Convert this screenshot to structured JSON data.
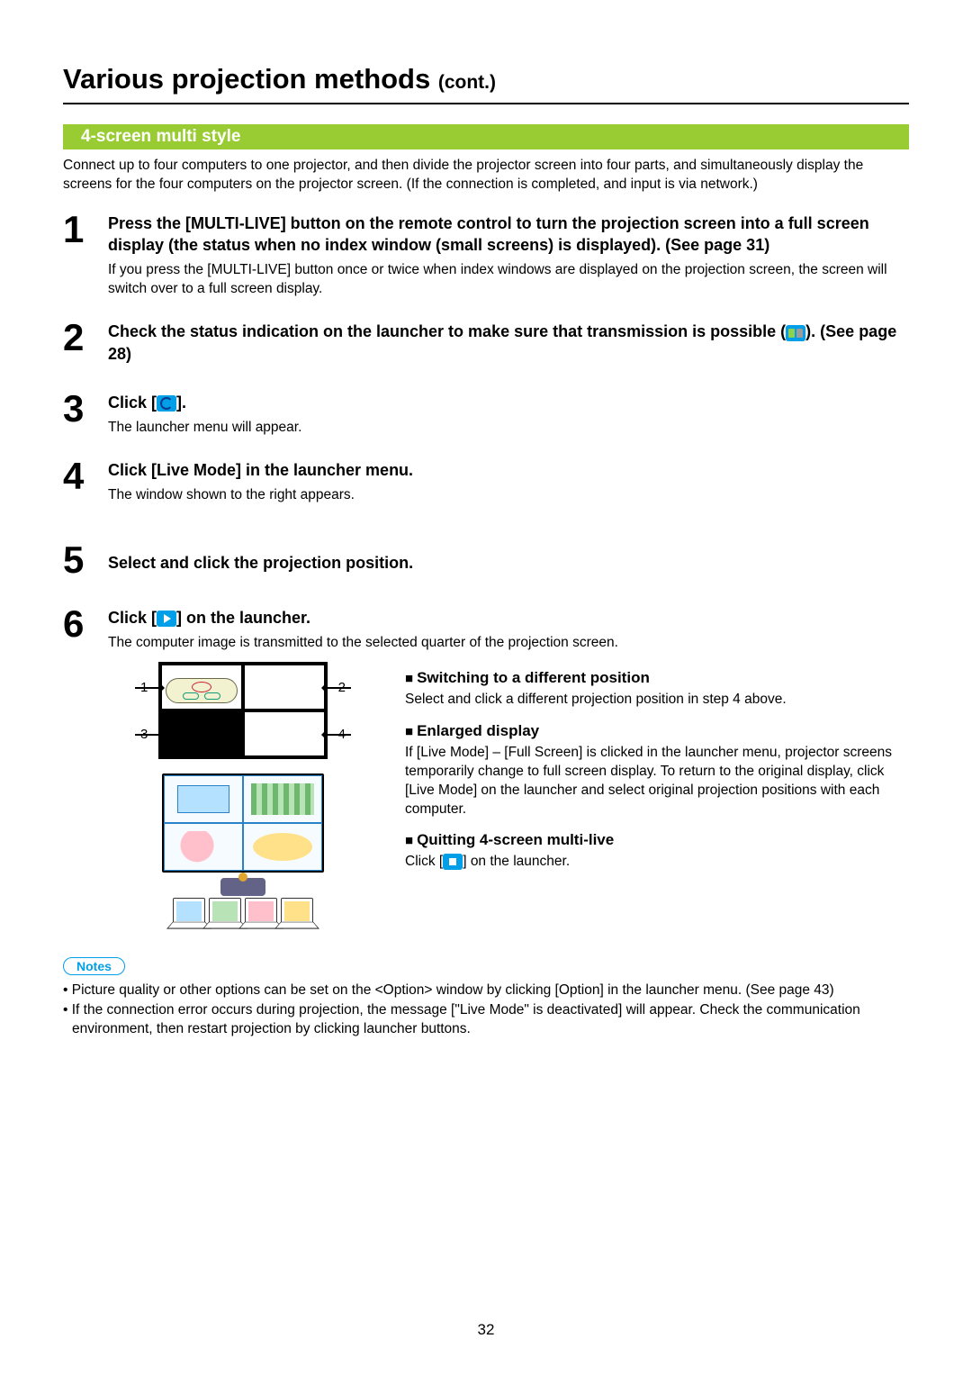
{
  "title_main": "Various projection methods ",
  "title_cont": "(cont.)",
  "section_heading": "4-screen multi style",
  "intro": "Connect up to four computers to one projector, and then divide the projector screen into four parts, and simultaneously display the screens for the four computers on the projector screen. (If the connection is completed, and input is via network.)",
  "steps": {
    "1": {
      "head": "Press the [MULTI-LIVE] button on the remote control to turn the projection screen into a full screen display (the status when no index window (small screens) is displayed). (See page 31)",
      "sub": "If you press the [MULTI-LIVE] button once or twice when index windows are displayed on the projection screen, the screen will switch over to a full screen display."
    },
    "2": {
      "head_pre": "Check the status indication on the launcher to make sure that transmission is possible (",
      "head_post": "). (See page 28)"
    },
    "3": {
      "head_pre": "Click [",
      "head_post": "].",
      "sub": "The launcher menu will appear."
    },
    "4": {
      "head": "Click [Live Mode] in the launcher menu.",
      "sub": "The window shown to the right appears."
    },
    "5": {
      "head": "Select and click the projection position."
    },
    "6": {
      "head_pre": "Click [",
      "head_post": "] on the launcher.",
      "sub": "The computer image is transmitted to the selected quarter of the projection screen."
    }
  },
  "quad_labels": {
    "tl": "1",
    "tr": "2",
    "bl": "3",
    "br": "4"
  },
  "info": {
    "switch_hd": "Switching to a different position",
    "switch_txt": "Select and click a different projection position in step 4 above.",
    "enl_hd": "Enlarged display",
    "enl_txt": "If [Live Mode] – [Full Screen] is clicked in the launcher menu, projector screens temporarily change to full screen display. To return to the original display, click [Live Mode] on the launcher and select original projection positions with each computer.",
    "quit_hd": "Quitting 4-screen multi-live",
    "quit_pre": "Click [",
    "quit_post": "] on the launcher."
  },
  "notes_label": "Notes",
  "notes": [
    "• Picture quality or other options can be set on the <Option> window by clicking [Option] in the launcher menu. (See page 43)",
    "• If the connection error occurs during projection, the message [\"Live Mode\" is deactivated] will appear. Check the communication environment, then restart projection by clicking launcher buttons."
  ],
  "page_number": "32"
}
